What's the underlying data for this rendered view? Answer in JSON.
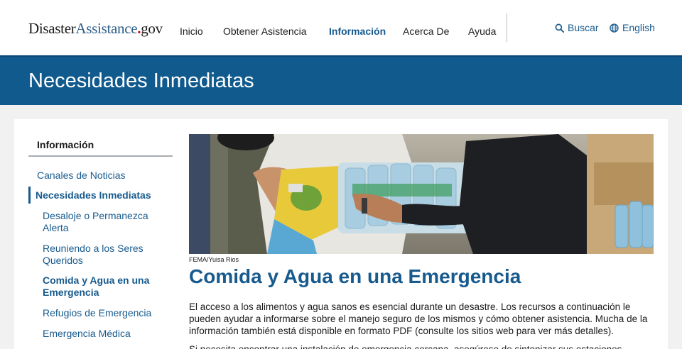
{
  "site": {
    "logo_part1": "Disaster",
    "logo_part2": "Assistance",
    "logo_dot": ".",
    "logo_part3": "gov"
  },
  "nav": {
    "items": [
      {
        "label": "Inicio"
      },
      {
        "label": "Obtener Asistencia"
      },
      {
        "label": "Información",
        "active": true
      },
      {
        "label": "Acerca De"
      },
      {
        "label": "Ayuda"
      }
    ],
    "search_label": "Buscar",
    "language_label": "English"
  },
  "banner": {
    "title": "Necesidades Inmediatas"
  },
  "sidebar": {
    "heading": "Información",
    "items": [
      {
        "label": "Canales de Noticias",
        "level": 1
      },
      {
        "label": "Necesidades Inmediatas",
        "level": 1,
        "current": true
      },
      {
        "label": "Desaloje o Permanezca Alerta",
        "level": 2
      },
      {
        "label": "Reuniendo a los Seres Queridos",
        "level": 2
      },
      {
        "label": "Comida y Agua en una Emergencia",
        "level": 2,
        "current": true
      },
      {
        "label": "Refugios de Emergencia",
        "level": 2
      },
      {
        "label": "Emergencia Médica",
        "level": 2
      }
    ]
  },
  "article": {
    "photo_credit": "FEMA/Yuisa Rios",
    "title": "Comida y Agua en una Emergencia",
    "paragraph1": "El acceso a los alimentos y agua sanos es esencial durante un desastre. Los recursos a continuación le pueden ayudar a informarse sobre el manejo seguro de los mismos y cómo obtener asistencia. Mucha de la información también está disponible en formato PDF (consulte los sitios web para ver más detalles).",
    "paragraph2": "Si necesita encontrar una instalación de emergencia cercana, asegúrese de sintonizar sus estaciones"
  },
  "colors": {
    "brand_blue": "#115a8e",
    "link_blue": "#175a8d",
    "accent_red": "#d0021b"
  }
}
